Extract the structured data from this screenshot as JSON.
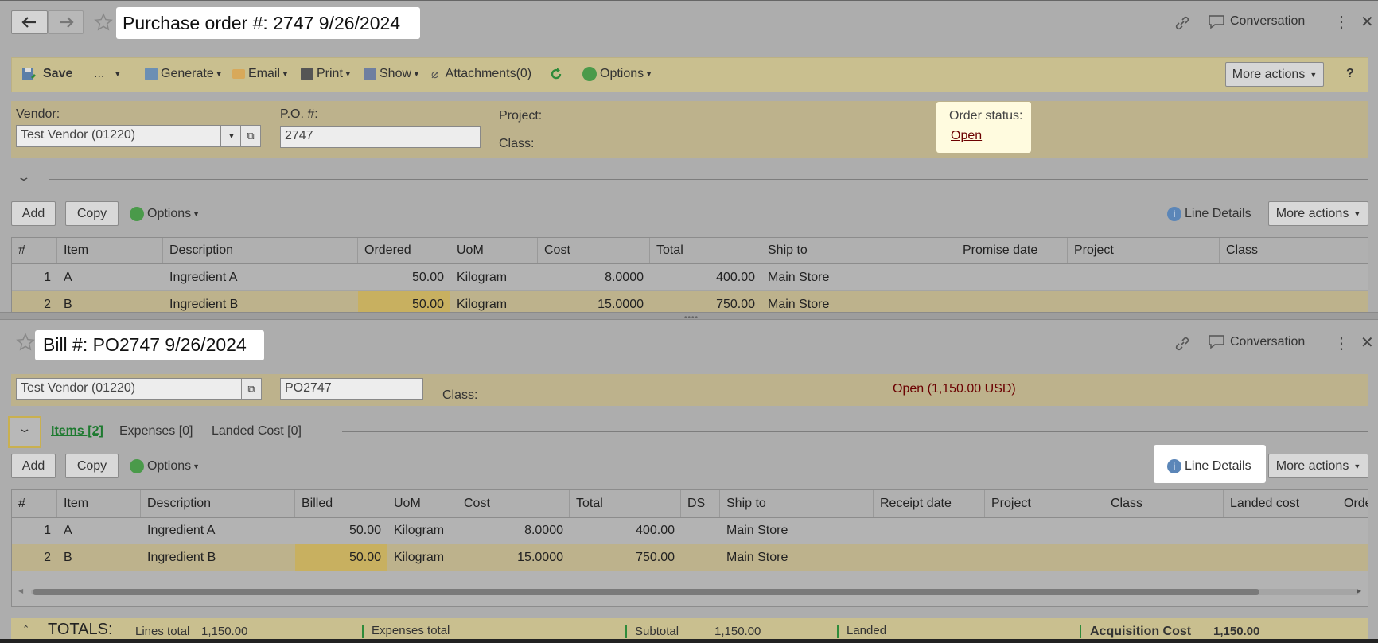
{
  "colors": {
    "toolbar": "#c9bf8f",
    "formbar": "#bdb28c",
    "selectedRow": "#bdb28c",
    "editedCell": "#c8b060",
    "link": "#6b0000",
    "green": "#2e8b3a"
  },
  "po": {
    "title": "Purchase order #: 2747 9/26/2024",
    "conversation": "Conversation",
    "toolbar": {
      "save": "Save",
      "more": "...",
      "generate": "Generate",
      "email": "Email",
      "print": "Print",
      "show": "Show",
      "attachments": "Attachments(0)",
      "options": "Options",
      "more_actions": "More actions",
      "help": "?"
    },
    "vendor_label": "Vendor:",
    "vendor_value": "Test Vendor (01220)",
    "po_label": "P.O. #:",
    "po_value": "2747",
    "project_label": "Project:",
    "class_label": "Class:",
    "status_label": "Order status:",
    "status_value": "Open",
    "grid_toolbar": {
      "add": "Add",
      "copy": "Copy",
      "options": "Options",
      "line_details": "Line Details",
      "more_actions": "More actions"
    },
    "columns": [
      "#",
      "Item",
      "Description",
      "Ordered",
      "UoM",
      "Cost",
      "Total",
      "Ship to",
      "Promise date",
      "Project",
      "Class"
    ],
    "rows": [
      {
        "n": "1",
        "item": "A",
        "desc": "Ingredient A",
        "qty": "50.00",
        "uom": "Kilogram",
        "cost": "8.0000",
        "total": "400.00",
        "ship": "Main Store"
      },
      {
        "n": "2",
        "item": "B",
        "desc": "Ingredient B",
        "qty": "50.00",
        "uom": "Kilogram",
        "cost": "15.0000",
        "total": "750.00",
        "ship": "Main Store"
      }
    ]
  },
  "bill": {
    "title": "Bill #: PO2747 9/26/2024",
    "conversation": "Conversation",
    "vendor_value": "Test Vendor (01220)",
    "ref_value": "PO2747",
    "class_label": "Class:",
    "status_value": "Open (1,150.00 USD)",
    "tabs": {
      "items": "Items [2]",
      "expenses": "Expenses [0]",
      "landed": "Landed Cost [0]"
    },
    "grid_toolbar": {
      "add": "Add",
      "copy": "Copy",
      "options": "Options",
      "line_details": "Line Details",
      "more_actions": "More actions"
    },
    "columns": [
      "#",
      "Item",
      "Description",
      "Billed",
      "UoM",
      "Cost",
      "Total",
      "DS",
      "Ship to",
      "Receipt date",
      "Project",
      "Class",
      "Landed cost",
      "Orde"
    ],
    "rows": [
      {
        "n": "1",
        "item": "A",
        "desc": "Ingredient A",
        "qty": "50.00",
        "uom": "Kilogram",
        "cost": "8.0000",
        "total": "400.00",
        "ship": "Main Store"
      },
      {
        "n": "2",
        "item": "B",
        "desc": "Ingredient B",
        "qty": "50.00",
        "uom": "Kilogram",
        "cost": "15.0000",
        "total": "750.00",
        "ship": "Main Store"
      }
    ],
    "totals": {
      "label": "TOTALS:",
      "lines_label": "Lines total",
      "lines_value": "1,150.00",
      "expenses_label": "Expenses total",
      "subtotal_label": "Subtotal",
      "subtotal_value": "1,150.00",
      "landed_label": "Landed",
      "acq_label": "Acquisition Cost",
      "acq_value": "1,150.00"
    }
  }
}
